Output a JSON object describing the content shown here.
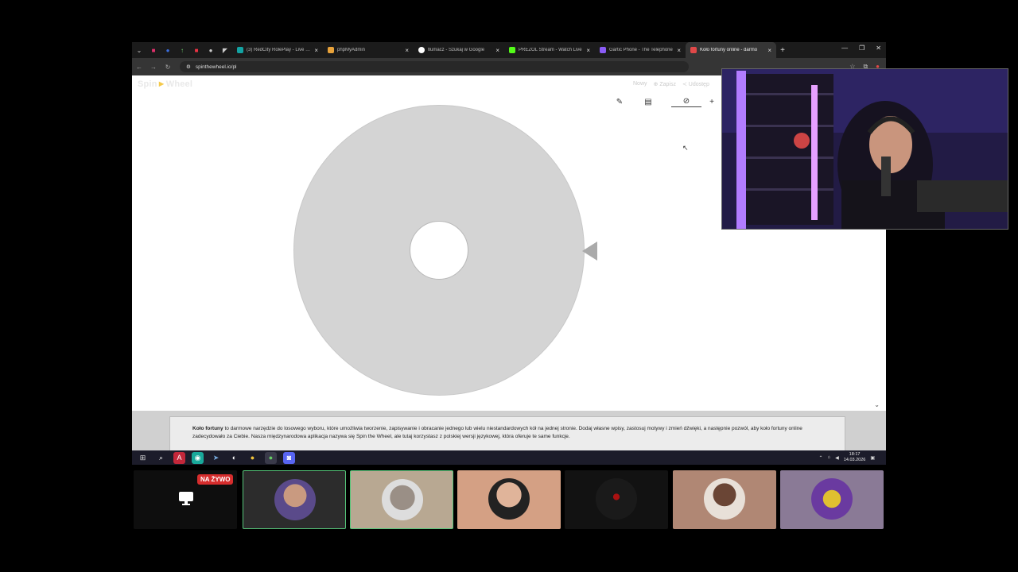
{
  "browser": {
    "tabs": [
      {
        "title": "(3) RedCity RolePlay - Live Co",
        "color": "#13a3a3",
        "active": false
      },
      {
        "title": "phpMyAdmin",
        "color": "#e8a23a",
        "active": false
      },
      {
        "title": "tłumacz - Szukaj w Google",
        "color": "#ffffff",
        "active": false
      },
      {
        "title": "PREZOL Stream - Watch Live",
        "color": "#53fc18",
        "active": false
      },
      {
        "title": "Gartic Phone - The Telephone",
        "color": "#8a5cf5",
        "active": false
      },
      {
        "title": "Koło fortuny online - darmo",
        "color": "#e04848",
        "active": true
      }
    ],
    "url": "spinthewheel.io/pl"
  },
  "site": {
    "logo_left": "Spin",
    "logo_arrow": "►",
    "logo_right": "Wheel",
    "nav": [
      "Nowy",
      "⊕ Zapisz",
      "≺ Udostęp"
    ]
  },
  "description": {
    "bold": "Koło fortuny",
    "text": " to darmowe narzędzie do losowego wyboru, które umożliwia tworzenie, zapisywanie i obracanie jednego lub wielu niestandardowych kół na jednej stronie. Dodaj własne wpisy, zastosuj motywy i zmień dźwięki, a następnie pozwól, aby koło fortuny online zadecydowało za Ciebie. Nasza międzynarodowa aplikacja nazywa się Spin the Wheel, ale tutaj korzystasz z polskiej wersji językowej, która oferuje te same funkcje."
  },
  "taskbar": {
    "time": "18:17",
    "date": "14.03.2026"
  },
  "stream": {
    "live_badge": "NA ŻYWO"
  },
  "colors": {
    "wheel": "#d4d4d4",
    "pointer": "#aaaaaa",
    "live": "#d62d2d"
  }
}
